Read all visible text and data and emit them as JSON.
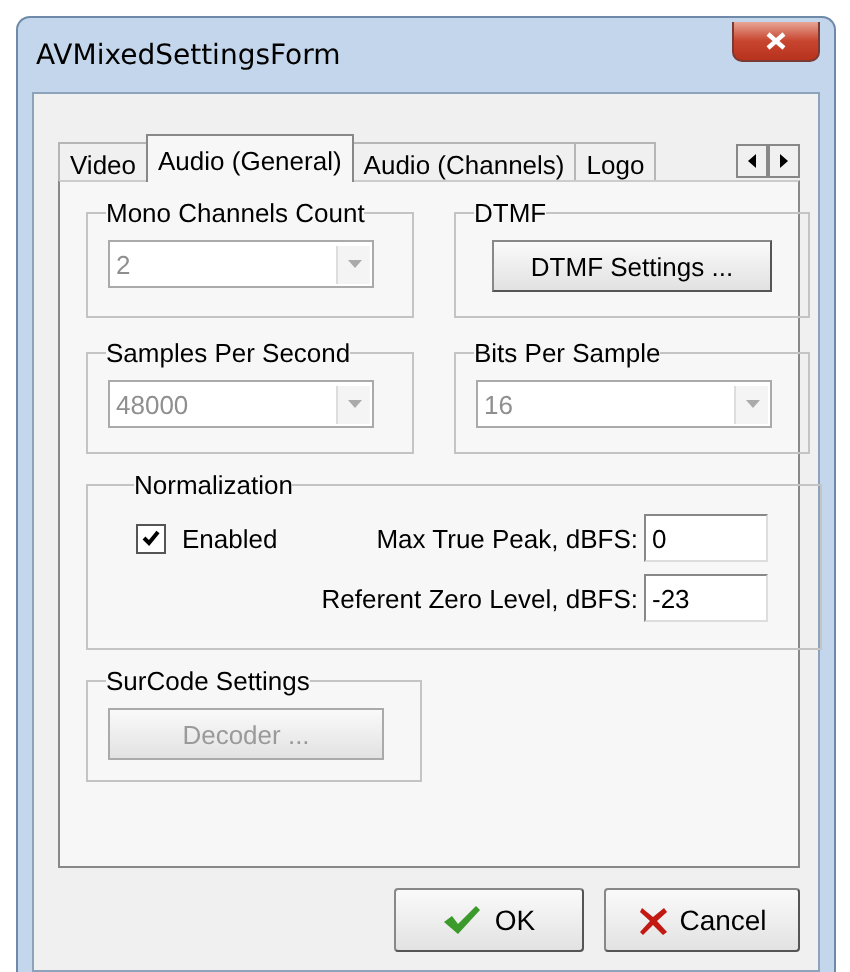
{
  "window": {
    "title": "AVMixedSettingsForm"
  },
  "tabs": [
    {
      "label": "Video",
      "selected": false
    },
    {
      "label": "Audio (General)",
      "selected": true
    },
    {
      "label": "Audio (Channels)",
      "selected": false
    },
    {
      "label": "Logo",
      "selected": false
    }
  ],
  "groups": [
    {
      "kind": "combo",
      "label": "Mono Channels Count",
      "value": "2",
      "disabled": true
    },
    {
      "kind": "button",
      "label": "DTMF",
      "button": {
        "label": "DTMF Settings ...",
        "disabled": false
      }
    },
    {
      "kind": "combo",
      "label": "Samples Per Second",
      "value": "48000",
      "disabled": true
    },
    {
      "kind": "combo",
      "label": "Bits Per Sample",
      "value": "16",
      "disabled": true
    }
  ],
  "normalization": {
    "label": "Normalization",
    "checkbox": {
      "label": "Enabled",
      "checked": true
    },
    "fields": [
      {
        "label": "Max True Peak, dBFS:",
        "value": "0"
      },
      {
        "label": "Referent Zero Level, dBFS:",
        "value": "-23"
      }
    ]
  },
  "surcode": {
    "label": "SurCode Settings",
    "button": {
      "label": "Decoder ...",
      "disabled": true
    }
  },
  "buttons": [
    {
      "kind": "ok",
      "label": "OK"
    },
    {
      "kind": "cancel",
      "label": "Cancel"
    }
  ]
}
